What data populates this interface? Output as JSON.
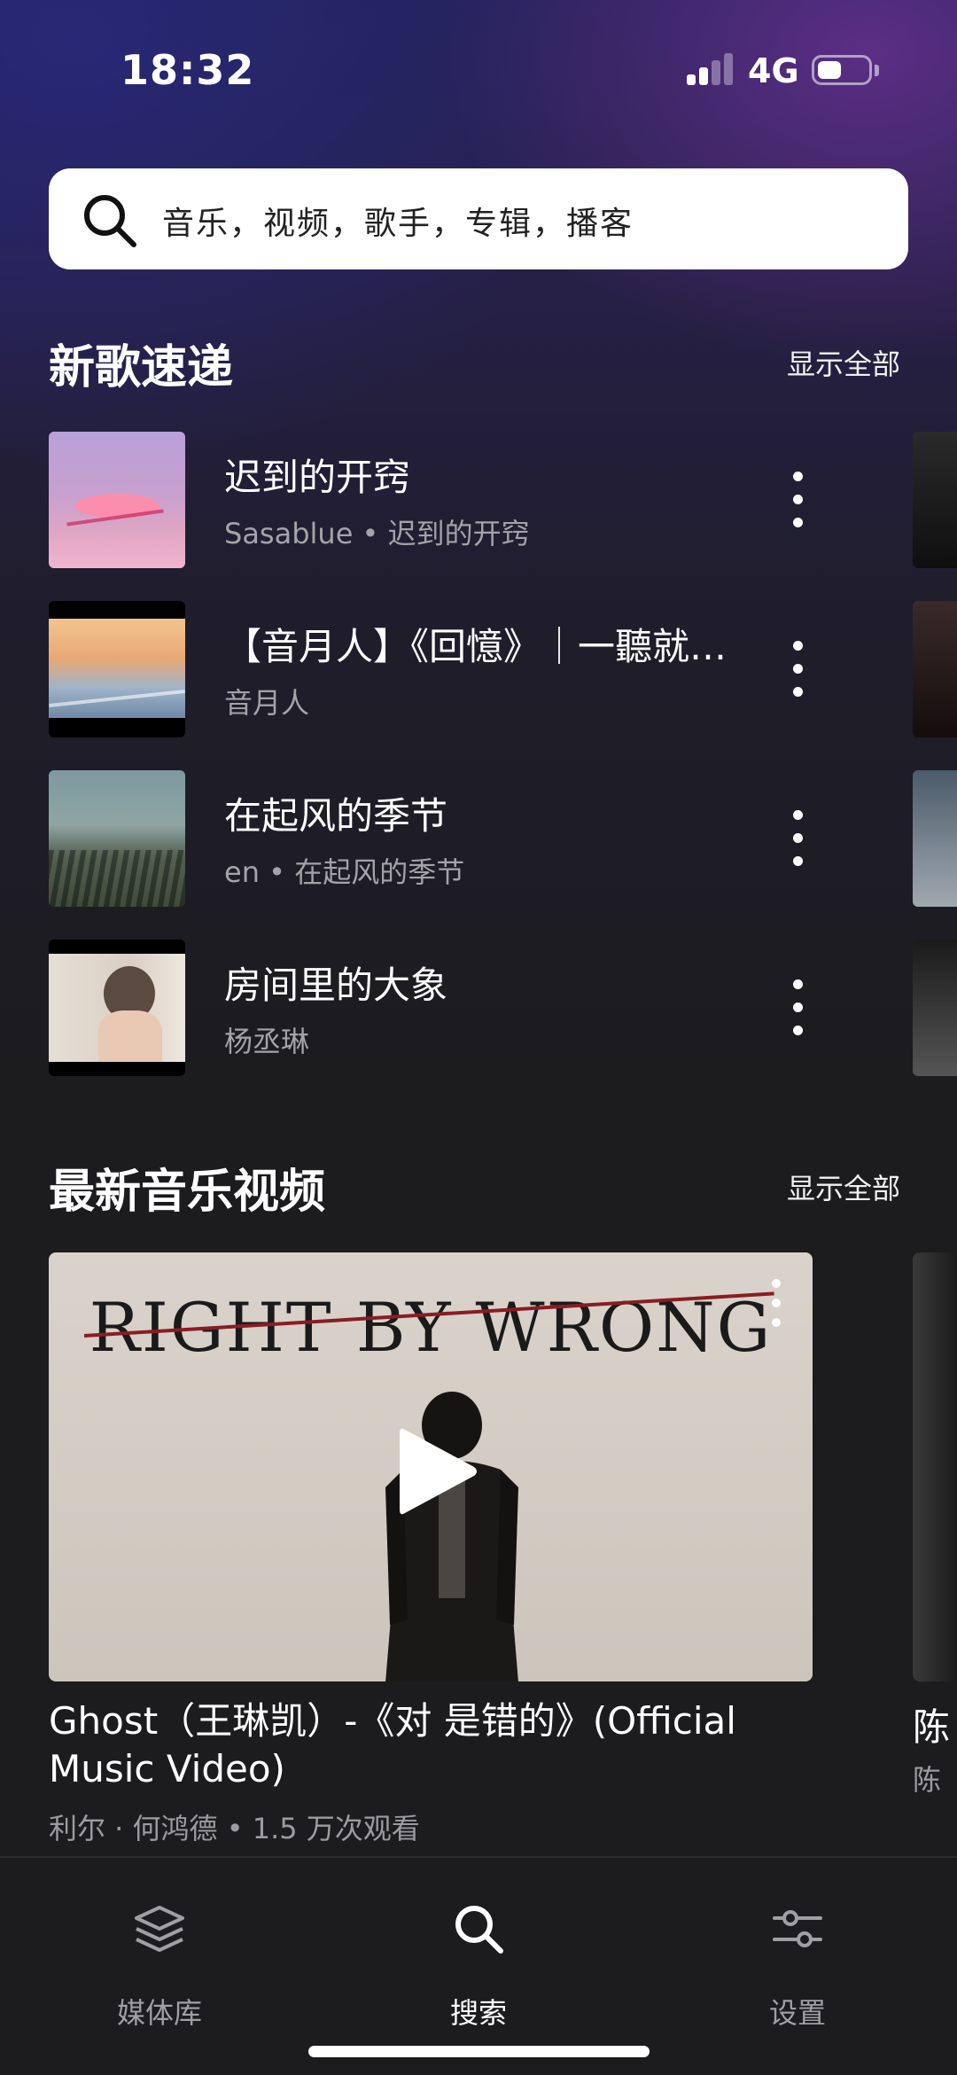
{
  "status_bar": {
    "time": "18:32",
    "network": "4G"
  },
  "search": {
    "placeholder": "音乐，视频，歌手，专辑，播客"
  },
  "new_songs": {
    "title": "新歌速递",
    "show_all": "显示全部",
    "items": [
      {
        "title": "迟到的开窍",
        "subtitle": "Sasablue • 迟到的开窍"
      },
      {
        "title": "【音月人】《回憶》｜一聽就會流淚的情歌",
        "subtitle": "音月人"
      },
      {
        "title": "在起风的季节",
        "subtitle": "en • 在起风的季节"
      },
      {
        "title": "房间里的大象",
        "subtitle": "杨丞琳"
      }
    ]
  },
  "music_videos": {
    "title": "最新音乐视频",
    "show_all": "显示全部",
    "featured": {
      "thumbnail_text": "RIGHT BY WRONG",
      "title": "Ghost（王琳凯）-《对 是错的》(Official Music Video)",
      "meta": "利尔 · 何鸿德 • 1.5 万次观看"
    },
    "peek": {
      "title": "陈",
      "meta": "陈"
    }
  },
  "tab_bar": {
    "items": [
      {
        "label": "媒体库",
        "icon": "library-icon",
        "active": false
      },
      {
        "label": "搜索",
        "icon": "search-icon",
        "active": true
      },
      {
        "label": "设置",
        "icon": "settings-icon",
        "active": false
      }
    ]
  },
  "colors": {
    "background": "#1c1c1e",
    "secondary_text": "#a3a3a8",
    "accent": "#ffffff"
  }
}
